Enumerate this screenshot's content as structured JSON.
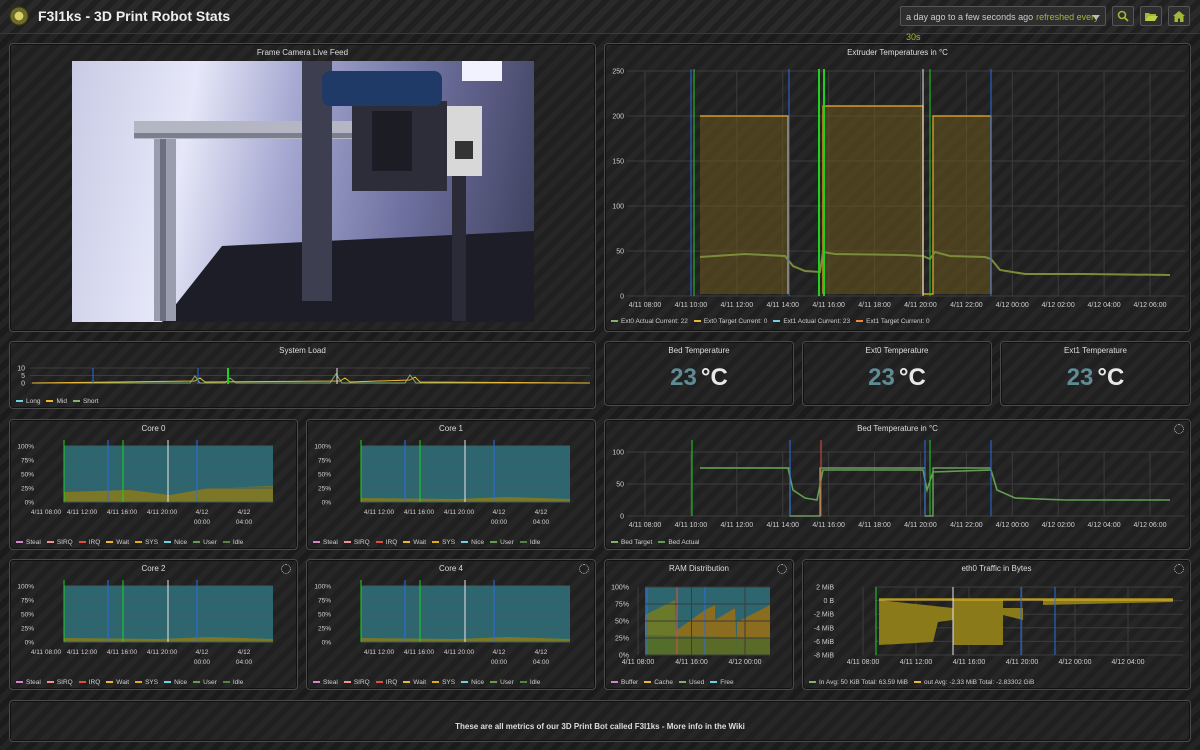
{
  "header": {
    "title": "F3l1ks - 3D Print Robot Stats",
    "time_range": "a day ago to a few seconds ago",
    "refresh": "refreshed every 30s"
  },
  "camera": {
    "title": "Frame Camera Live Feed"
  },
  "extruder": {
    "title": "Extruder Temperatures in °C",
    "y_ticks": [
      "250",
      "200",
      "150",
      "100",
      "50",
      "0"
    ],
    "x_ticks": [
      "4/11 08:00",
      "4/11 10:00",
      "4/11 12:00",
      "4/11 14:00",
      "4/11 16:00",
      "4/11 18:00",
      "4/11 20:00",
      "4/11 22:00",
      "4/12 00:00",
      "4/12 02:00",
      "4/12 04:00",
      "4/12 06:00"
    ],
    "legend": [
      {
        "label": "Ext0 Actual  Current: 22",
        "color": "#7eb26d"
      },
      {
        "label": "Ext0 Target  Current: 0",
        "color": "#eab839"
      },
      {
        "label": "Ext1 Actual  Current: 23",
        "color": "#6ed0e0"
      },
      {
        "label": "Ext1 Target  Current: 0",
        "color": "#ef843c"
      }
    ]
  },
  "system_load": {
    "title": "System Load",
    "y_ticks": [
      "10",
      "5",
      "0"
    ],
    "legend": [
      {
        "label": "Long",
        "color": "#6ed0e0"
      },
      {
        "label": "Mid",
        "color": "#eab839"
      },
      {
        "label": "Short",
        "color": "#7eb26d"
      }
    ]
  },
  "stats": [
    {
      "title": "Bed Temperature",
      "value": "23",
      "unit": "°C"
    },
    {
      "title": "Ext0 Temperature",
      "value": "23",
      "unit": "°C"
    },
    {
      "title": "Ext1 Temperature",
      "value": "23",
      "unit": "°C"
    }
  ],
  "core_legend": [
    {
      "label": "Steal",
      "color": "#d683ce"
    },
    {
      "label": "SIRQ",
      "color": "#f29191"
    },
    {
      "label": "IRQ",
      "color": "#e24d42"
    },
    {
      "label": "Wait",
      "color": "#eab839"
    },
    {
      "label": "SYS",
      "color": "#e5ac0e"
    },
    {
      "label": "Nice",
      "color": "#6ed0e0"
    },
    {
      "label": "User",
      "color": "#629e51"
    },
    {
      "label": "Idle",
      "color": "#508642"
    }
  ],
  "pct_ticks": [
    "100%",
    "75%",
    "50%",
    "25%",
    "0%"
  ],
  "cores": [
    {
      "title": "Core 0",
      "x_ticks": [
        "4/11 08:00",
        "4/11 12:00",
        "4/11 16:00",
        "4/11 20:00",
        "4/12|00:00",
        "4/12|04:00"
      ]
    },
    {
      "title": "Core 1",
      "x_ticks": [
        "4/11 12:00",
        "4/11 16:00",
        "4/11 20:00",
        "4/12|00:00",
        "4/12|04:00"
      ]
    },
    {
      "title": "Core 2",
      "x_ticks": [
        "4/11 08:00",
        "4/11 12:00",
        "4/11 16:00",
        "4/11 20:00",
        "4/12|00:00",
        "4/12|04:00"
      ]
    },
    {
      "title": "Core 4",
      "x_ticks": [
        "4/11 12:00",
        "4/11 16:00",
        "4/11 20:00",
        "4/12|00:00",
        "4/12|04:00"
      ]
    }
  ],
  "bed": {
    "title": "Bed Temperature in °C",
    "y_ticks": [
      "100",
      "50",
      "0"
    ],
    "x_ticks": [
      "4/11 08:00",
      "4/11 10:00",
      "4/11 12:00",
      "4/11 14:00",
      "4/11 16:00",
      "4/11 18:00",
      "4/11 20:00",
      "4/11 22:00",
      "4/12 00:00",
      "4/12 02:00",
      "4/12 04:00",
      "4/12 06:00"
    ],
    "legend": [
      {
        "label": "Bed Target",
        "color": "#7eb26d"
      },
      {
        "label": "Bed Actual",
        "color": "#629e51"
      }
    ]
  },
  "ram": {
    "title": "RAM Distribution",
    "x_ticks": [
      "4/11 08:00",
      "4/11 16:00",
      "4/12 00:00"
    ],
    "legend": [
      {
        "label": "Buffer",
        "color": "#d683ce"
      },
      {
        "label": "Cache",
        "color": "#eab839"
      },
      {
        "label": "Used",
        "color": "#7eb26d"
      },
      {
        "label": "Free",
        "color": "#6ed0e0"
      }
    ]
  },
  "eth0": {
    "title": "eth0 Traffic in Bytes",
    "y_ticks": [
      "2 MiB",
      "0 B",
      "-2 MiB",
      "-4 MiB",
      "-6 MiB",
      "-8 MiB"
    ],
    "x_ticks": [
      "4/11 08:00",
      "4/11 12:00",
      "4/11 16:00",
      "4/11 20:00",
      "4/12 00:00",
      "4/12 04:00"
    ],
    "legend": [
      {
        "label": "In  Avg: 50 KiB  Total: 63.59 MiB",
        "color": "#7eb26d"
      },
      {
        "label": "out  Avg: -2.33 MiB  Total: -2.83302 GiB",
        "color": "#eab839"
      }
    ]
  },
  "footer": {
    "text": "These are all metrics of our 3D Print Bot called F3l1ks - More info in the Wiki"
  }
}
